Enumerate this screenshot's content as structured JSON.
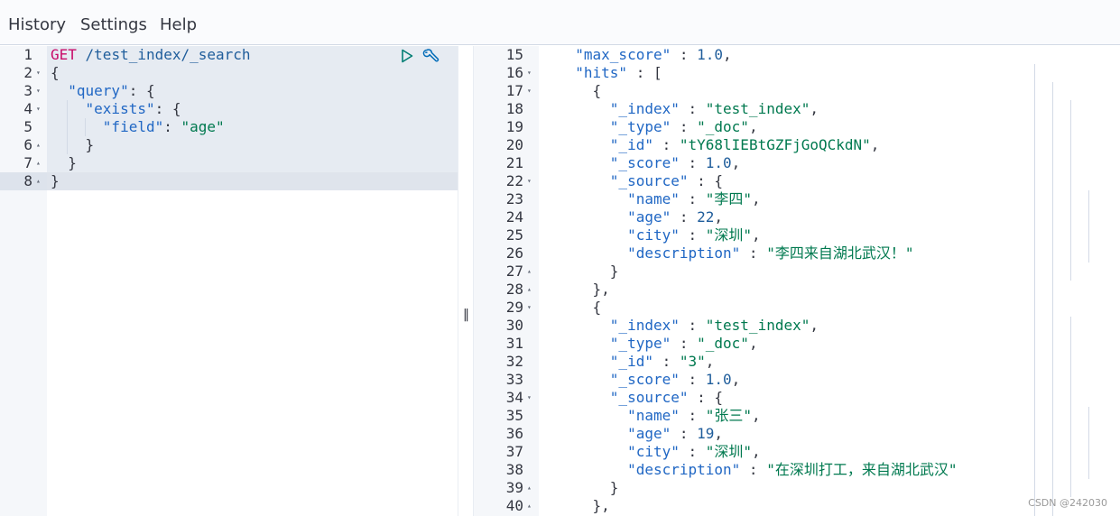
{
  "menu": {
    "history": "History",
    "settings": "Settings",
    "help": "Help"
  },
  "request": {
    "lines": [
      {
        "num": "1",
        "fold": "",
        "tokens": [
          [
            "k-method",
            "GET"
          ],
          [
            "k-url",
            " /test_index/_search"
          ]
        ]
      },
      {
        "num": "2",
        "fold": "down",
        "tokens": [
          [
            "k-punc",
            "{"
          ]
        ]
      },
      {
        "num": "3",
        "fold": "down",
        "tokens": [
          [
            "k-punc",
            "  "
          ],
          [
            "k-key",
            "\"query\""
          ],
          [
            "k-punc",
            ": {"
          ]
        ]
      },
      {
        "num": "4",
        "fold": "down",
        "tokens": [
          [
            "k-punc",
            "    "
          ],
          [
            "k-key",
            "\"exists\""
          ],
          [
            "k-punc",
            ": {"
          ]
        ]
      },
      {
        "num": "5",
        "fold": "",
        "tokens": [
          [
            "k-punc",
            "      "
          ],
          [
            "k-key",
            "\"field\""
          ],
          [
            "k-punc",
            ": "
          ],
          [
            "k-str",
            "\"age\""
          ]
        ]
      },
      {
        "num": "6",
        "fold": "up",
        "tokens": [
          [
            "k-punc",
            "    }"
          ]
        ]
      },
      {
        "num": "7",
        "fold": "up",
        "tokens": [
          [
            "k-punc",
            "  }"
          ]
        ]
      },
      {
        "num": "8",
        "fold": "up",
        "tokens": [
          [
            "k-punc",
            "}"
          ]
        ]
      }
    ]
  },
  "response": {
    "lines": [
      {
        "num": "15",
        "fold": "",
        "tokens": [
          [
            "k-punc",
            "  "
          ],
          [
            "k-key",
            "\"max_score\""
          ],
          [
            "k-punc",
            " : "
          ],
          [
            "k-num",
            "1.0"
          ],
          [
            "k-punc",
            ","
          ]
        ]
      },
      {
        "num": "16",
        "fold": "down",
        "tokens": [
          [
            "k-punc",
            "  "
          ],
          [
            "k-key",
            "\"hits\""
          ],
          [
            "k-punc",
            " : ["
          ]
        ]
      },
      {
        "num": "17",
        "fold": "down",
        "tokens": [
          [
            "k-punc",
            "    {"
          ]
        ]
      },
      {
        "num": "18",
        "fold": "",
        "tokens": [
          [
            "k-punc",
            "      "
          ],
          [
            "k-key",
            "\"_index\""
          ],
          [
            "k-punc",
            " : "
          ],
          [
            "k-str",
            "\"test_index\""
          ],
          [
            "k-punc",
            ","
          ]
        ]
      },
      {
        "num": "19",
        "fold": "",
        "tokens": [
          [
            "k-punc",
            "      "
          ],
          [
            "k-key",
            "\"_type\""
          ],
          [
            "k-punc",
            " : "
          ],
          [
            "k-str",
            "\"_doc\""
          ],
          [
            "k-punc",
            ","
          ]
        ]
      },
      {
        "num": "20",
        "fold": "",
        "tokens": [
          [
            "k-punc",
            "      "
          ],
          [
            "k-key",
            "\"_id\""
          ],
          [
            "k-punc",
            " : "
          ],
          [
            "k-str",
            "\"tY68lIEBtGZFjGoQCkdN\""
          ],
          [
            "k-punc",
            ","
          ]
        ]
      },
      {
        "num": "21",
        "fold": "",
        "tokens": [
          [
            "k-punc",
            "      "
          ],
          [
            "k-key",
            "\"_score\""
          ],
          [
            "k-punc",
            " : "
          ],
          [
            "k-num",
            "1.0"
          ],
          [
            "k-punc",
            ","
          ]
        ]
      },
      {
        "num": "22",
        "fold": "down",
        "tokens": [
          [
            "k-punc",
            "      "
          ],
          [
            "k-key",
            "\"_source\""
          ],
          [
            "k-punc",
            " : {"
          ]
        ]
      },
      {
        "num": "23",
        "fold": "",
        "tokens": [
          [
            "k-punc",
            "        "
          ],
          [
            "k-key",
            "\"name\""
          ],
          [
            "k-punc",
            " : "
          ],
          [
            "k-str",
            "\"李四\""
          ],
          [
            "k-punc",
            ","
          ]
        ]
      },
      {
        "num": "24",
        "fold": "",
        "tokens": [
          [
            "k-punc",
            "        "
          ],
          [
            "k-key",
            "\"age\""
          ],
          [
            "k-punc",
            " : "
          ],
          [
            "k-num",
            "22"
          ],
          [
            "k-punc",
            ","
          ]
        ]
      },
      {
        "num": "25",
        "fold": "",
        "tokens": [
          [
            "k-punc",
            "        "
          ],
          [
            "k-key",
            "\"city\""
          ],
          [
            "k-punc",
            " : "
          ],
          [
            "k-str",
            "\"深圳\""
          ],
          [
            "k-punc",
            ","
          ]
        ]
      },
      {
        "num": "26",
        "fold": "",
        "tokens": [
          [
            "k-punc",
            "        "
          ],
          [
            "k-key",
            "\"description\""
          ],
          [
            "k-punc",
            " : "
          ],
          [
            "k-str",
            "\"李四来自湖北武汉！\""
          ]
        ]
      },
      {
        "num": "27",
        "fold": "up",
        "tokens": [
          [
            "k-punc",
            "      }"
          ]
        ]
      },
      {
        "num": "28",
        "fold": "up",
        "tokens": [
          [
            "k-punc",
            "    },"
          ]
        ]
      },
      {
        "num": "29",
        "fold": "down",
        "tokens": [
          [
            "k-punc",
            "    {"
          ]
        ]
      },
      {
        "num": "30",
        "fold": "",
        "tokens": [
          [
            "k-punc",
            "      "
          ],
          [
            "k-key",
            "\"_index\""
          ],
          [
            "k-punc",
            " : "
          ],
          [
            "k-str",
            "\"test_index\""
          ],
          [
            "k-punc",
            ","
          ]
        ]
      },
      {
        "num": "31",
        "fold": "",
        "tokens": [
          [
            "k-punc",
            "      "
          ],
          [
            "k-key",
            "\"_type\""
          ],
          [
            "k-punc",
            " : "
          ],
          [
            "k-str",
            "\"_doc\""
          ],
          [
            "k-punc",
            ","
          ]
        ]
      },
      {
        "num": "32",
        "fold": "",
        "tokens": [
          [
            "k-punc",
            "      "
          ],
          [
            "k-key",
            "\"_id\""
          ],
          [
            "k-punc",
            " : "
          ],
          [
            "k-str",
            "\"3\""
          ],
          [
            "k-punc",
            ","
          ]
        ]
      },
      {
        "num": "33",
        "fold": "",
        "tokens": [
          [
            "k-punc",
            "      "
          ],
          [
            "k-key",
            "\"_score\""
          ],
          [
            "k-punc",
            " : "
          ],
          [
            "k-num",
            "1.0"
          ],
          [
            "k-punc",
            ","
          ]
        ]
      },
      {
        "num": "34",
        "fold": "down",
        "tokens": [
          [
            "k-punc",
            "      "
          ],
          [
            "k-key",
            "\"_source\""
          ],
          [
            "k-punc",
            " : {"
          ]
        ]
      },
      {
        "num": "35",
        "fold": "",
        "tokens": [
          [
            "k-punc",
            "        "
          ],
          [
            "k-key",
            "\"name\""
          ],
          [
            "k-punc",
            " : "
          ],
          [
            "k-str",
            "\"张三\""
          ],
          [
            "k-punc",
            ","
          ]
        ]
      },
      {
        "num": "36",
        "fold": "",
        "tokens": [
          [
            "k-punc",
            "        "
          ],
          [
            "k-key",
            "\"age\""
          ],
          [
            "k-punc",
            " : "
          ],
          [
            "k-num",
            "19"
          ],
          [
            "k-punc",
            ","
          ]
        ]
      },
      {
        "num": "37",
        "fold": "",
        "tokens": [
          [
            "k-punc",
            "        "
          ],
          [
            "k-key",
            "\"city\""
          ],
          [
            "k-punc",
            " : "
          ],
          [
            "k-str",
            "\"深圳\""
          ],
          [
            "k-punc",
            ","
          ]
        ]
      },
      {
        "num": "38",
        "fold": "",
        "tokens": [
          [
            "k-punc",
            "        "
          ],
          [
            "k-key",
            "\"description\""
          ],
          [
            "k-punc",
            " : "
          ],
          [
            "k-str",
            "\"在深圳打工，来自湖北武汉\""
          ]
        ]
      },
      {
        "num": "39",
        "fold": "up",
        "tokens": [
          [
            "k-punc",
            "      }"
          ]
        ]
      },
      {
        "num": "40",
        "fold": "up",
        "tokens": [
          [
            "k-punc",
            "    },"
          ]
        ]
      }
    ]
  },
  "icons": {
    "run": "play-icon",
    "settings": "wrench-icon",
    "divider": "resize-grip-icon"
  },
  "divider_grip": "‖",
  "watermark": "CSDN @242030"
}
